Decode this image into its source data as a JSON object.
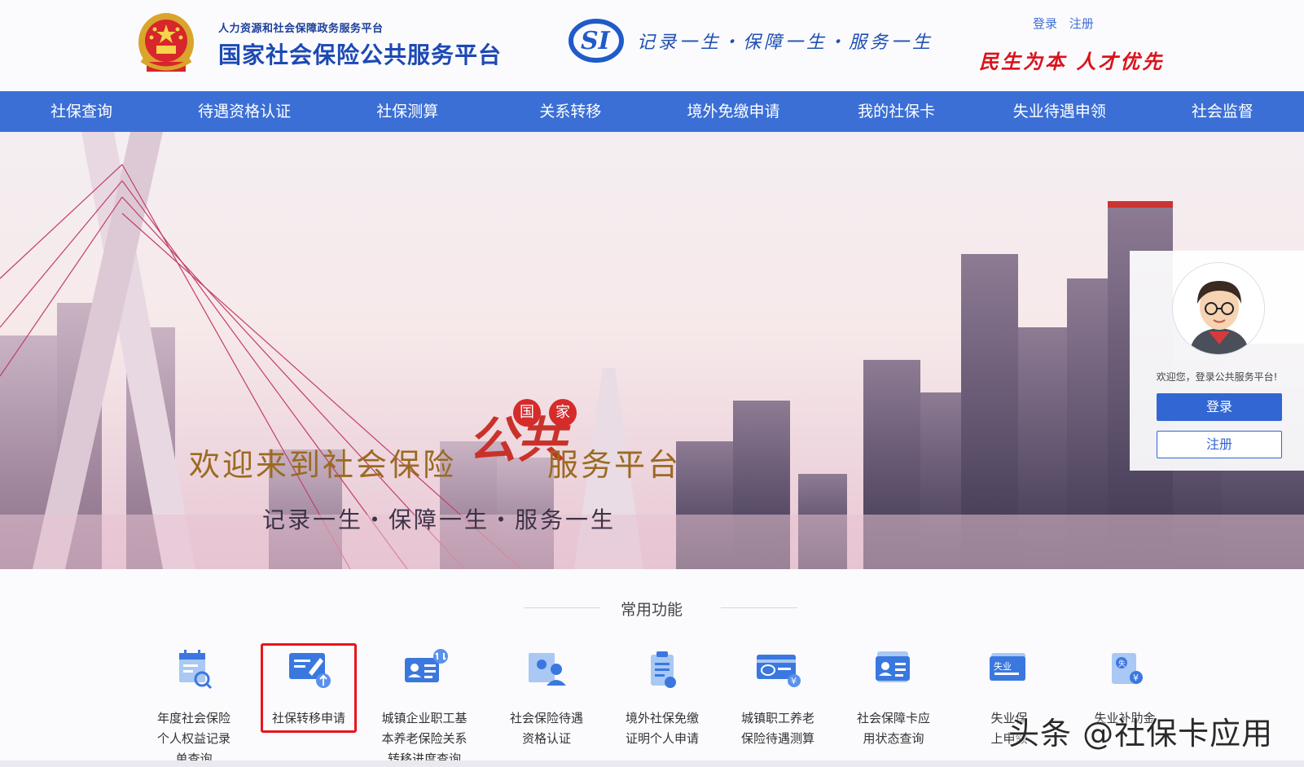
{
  "header": {
    "ministry_subtitle": "人力资源和社会保障政务服务平台",
    "site_title": "国家社会保险公共服务平台",
    "si_logo_text": "SI",
    "slogan": "记录一生・保障一生・服务一生",
    "login_link": "登录",
    "register_link": "注册",
    "motto": "民生为本 人才优先"
  },
  "nav": {
    "items": [
      "社保查询",
      "待遇资格认证",
      "社保测算",
      "关系转移",
      "境外免缴申请",
      "我的社保卡",
      "失业待遇申领",
      "社会监督"
    ]
  },
  "banner": {
    "welcome_part1": "欢迎来到社会保险",
    "gong": "公共",
    "badge_guo": "国",
    "badge_jia": "家",
    "welcome_part2": "服务平台",
    "slogan": "记录一生・保障一生・服务一生",
    "carousel_active_index": 2
  },
  "login_card": {
    "welcome": "欢迎您，登录公共服务平台!",
    "login_button": "登录",
    "register_button": "注册"
  },
  "common_functions": {
    "title": "常用功能",
    "items": [
      {
        "label": "年度社会保险个人权益记录单查询",
        "icon": "calendar-search-icon"
      },
      {
        "label": "社保转移申请",
        "icon": "transfer-card-icon"
      },
      {
        "label": "城镇企业职工基本养老保险关系转移进度查询",
        "icon": "id-transfer-icon"
      },
      {
        "label": "社会保险待遇资格认证",
        "icon": "user-verify-icon"
      },
      {
        "label": "境外社保免缴证明个人申请",
        "icon": "clipboard-icon"
      },
      {
        "label": "城镇职工养老保险待遇测算",
        "icon": "si-card-yen-icon"
      },
      {
        "label": "社会保障卡应用状态查询",
        "icon": "card-status-icon"
      },
      {
        "label": "失业保险金网上申领",
        "icon": "unemployment-card-icon"
      },
      {
        "label": "失业补助金申领",
        "icon": "subsidy-yen-icon"
      }
    ],
    "item_labels_lines": [
      [
        "年度社会保险",
        "个人权益记录",
        "单查询"
      ],
      [
        "社保转移申请"
      ],
      [
        "城镇企业职工基",
        "本养老保险关系",
        "转移进度查询"
      ],
      [
        "社会保险待遇",
        "资格认证"
      ],
      [
        "境外社保免缴",
        "证明个人申请"
      ],
      [
        "城镇职工养老",
        "保险待遇测算"
      ],
      [
        "社会保障卡应",
        "用状态查询"
      ],
      [
        "失业保",
        "上申领"
      ],
      [
        "失业补助金",
        ""
      ]
    ],
    "highlighted_index": 1
  },
  "watermark": "头条 @社保卡应用",
  "colors": {
    "nav_blue": "#3b6fd6",
    "title_blue": "#1c49b4",
    "motto_red": "#d8141c",
    "highlight_red": "#e8141c",
    "icon_blue": "#3a78e0"
  }
}
